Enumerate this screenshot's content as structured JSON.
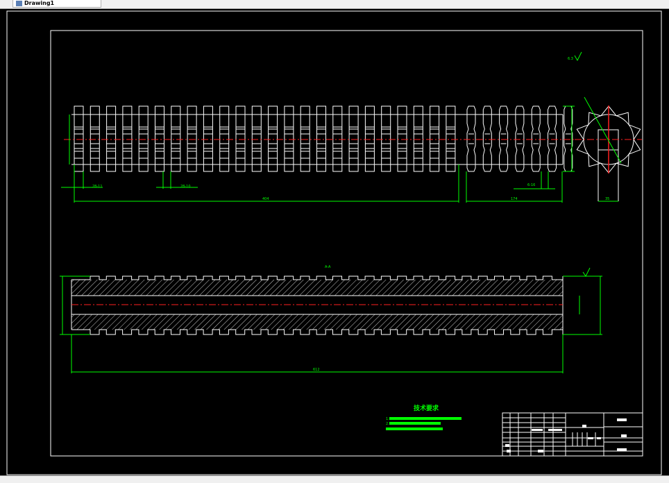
{
  "window": {
    "tab_label": "Drawing1",
    "tab_icon": "drawing-file-icon"
  },
  "colors": {
    "background": "#000000",
    "geometry": "#ffffff",
    "dimension": "#00ff00",
    "centerline": "#ff2020"
  },
  "drawing": {
    "dimensions": {
      "top_overall_left": "404",
      "top_overall_right": "174",
      "end_view_width": "35",
      "pitch_label_1": "28-11",
      "pitch_label_2": "28-10",
      "spline_label": "6-16",
      "section_length": "612",
      "section_label": "A-A",
      "roughness": "6.3"
    },
    "tech_requirements": {
      "title": "技术要求",
      "line1": "1. ",
      "line2": "2. "
    }
  }
}
